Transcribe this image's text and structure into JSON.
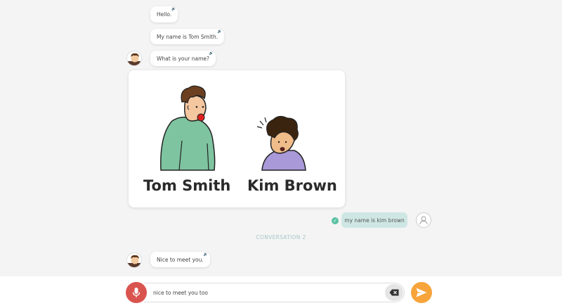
{
  "messages": {
    "hello": "Hello.",
    "intro": "My name is Tom Smith.",
    "question": "What is your name?",
    "nice": "Nice to meet you."
  },
  "card": {
    "person1": "Tom Smith",
    "person2": "Kim Brown"
  },
  "user_reply": "my name is kim brown",
  "divider": "CONVERSATION 2",
  "input": {
    "value": "nice to meet you too"
  },
  "colors": {
    "mic": "#d9534f",
    "send": "#f7a43a",
    "user_bubble": "#cfe7e4",
    "check": "#59c2a2"
  },
  "icons": {
    "speaker": "speaker-icon",
    "mic": "microphone-icon",
    "send": "send-icon",
    "clear": "backspace-icon",
    "check": "check-icon"
  }
}
